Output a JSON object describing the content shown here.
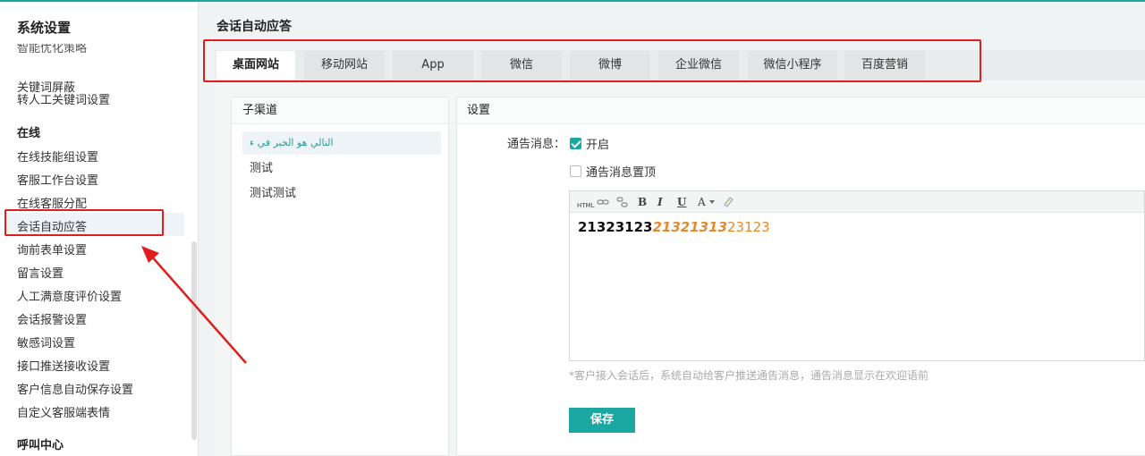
{
  "sidebar": {
    "title": "系统设置",
    "cut_item": "智能优化策略",
    "items_top": [
      "关键词屏蔽",
      "转人工关键词设置"
    ],
    "section_online": "在线",
    "items_online": [
      "在线技能组设置",
      "客服工作台设置",
      "在线客服分配",
      "会话自动应答",
      "询前表单设置",
      "留言设置",
      "人工满意度评价设置",
      "会话报警设置",
      "敏感词设置",
      "接口推送接收设置",
      "客户信息自动保存设置",
      "自定义客服端表情"
    ],
    "section_call": "呼叫中心"
  },
  "page": {
    "title": "会话自动应答"
  },
  "tabs": [
    "桌面网站",
    "移动网站",
    "App",
    "微信",
    "微博",
    "企业微信",
    "微信小程序",
    "百度营销"
  ],
  "subchannel": {
    "header": "子渠道",
    "items": [
      "التالي هو الخبر في ء",
      "测试",
      "测试测试"
    ]
  },
  "settings": {
    "header": "设置",
    "notice_label": "通告消息：",
    "enable_label": "开启",
    "pin_label": "通告消息置顶",
    "toolbar": {
      "html": "HTML",
      "bold": "B",
      "italic": "I",
      "underline": "U",
      "font": "A"
    },
    "editor_bold": "21323123",
    "editor_italic": "21321313",
    "editor_plain": "23123",
    "hint": "*客户接入会话后，系统自动给客户推送通告消息，通告消息显示在欢迎语前",
    "save_label": "保存"
  },
  "colors": {
    "accent": "#1aa7a1",
    "annotation": "#e21d1d",
    "highlight_text": "#e58a2c"
  }
}
